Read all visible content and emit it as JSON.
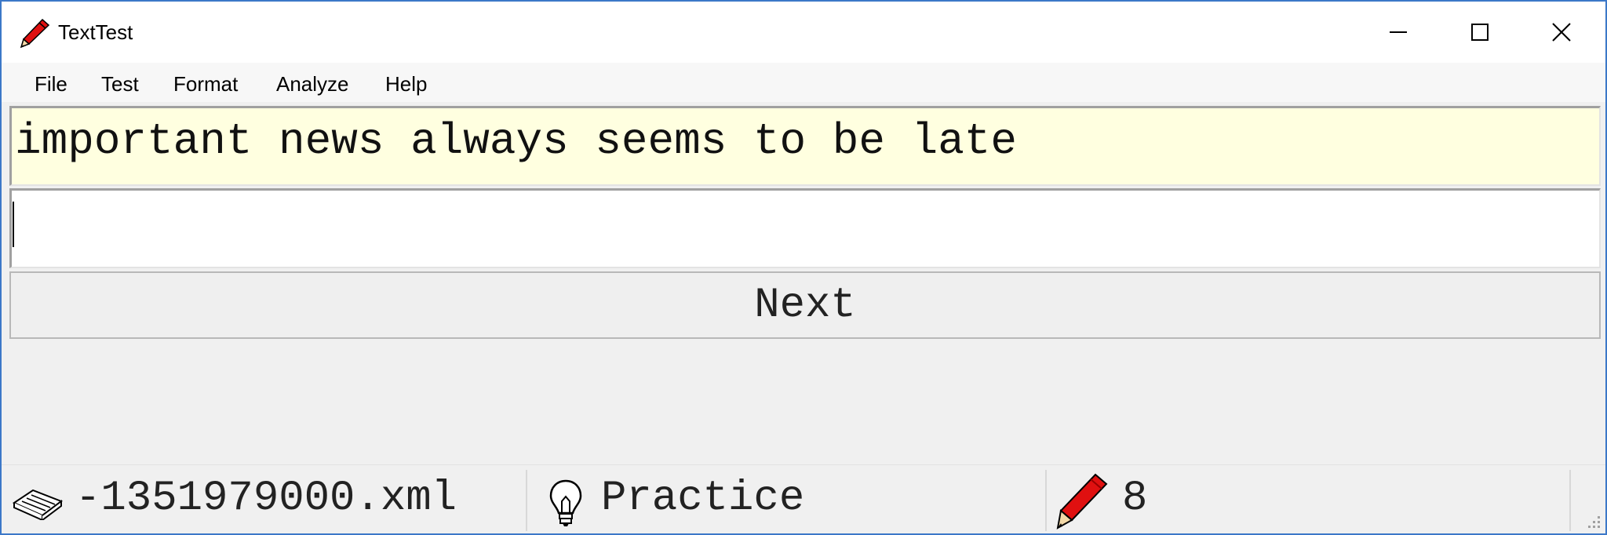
{
  "window": {
    "title": "TextTest",
    "app_icon": "red-pencil-icon",
    "controls": [
      "minimize-icon",
      "maximize-icon",
      "close-icon"
    ]
  },
  "menu": {
    "items": [
      "File",
      "Test",
      "Format",
      "Analyze",
      "Help"
    ]
  },
  "prompt": {
    "text": "important news always seems to be late",
    "background": "#ffffe0"
  },
  "typing": {
    "value": "",
    "placeholder": ""
  },
  "next_button": {
    "label": "Next"
  },
  "status": {
    "file_icon": "open-book-icon",
    "file_name": "-1351979000.xml",
    "mode_icon": "lightbulb-icon",
    "mode": "Practice",
    "count_icon": "red-pencil-icon",
    "count": "8"
  },
  "colors": {
    "accent_border": "#3c78c8",
    "pencil_red": "#e01010"
  }
}
